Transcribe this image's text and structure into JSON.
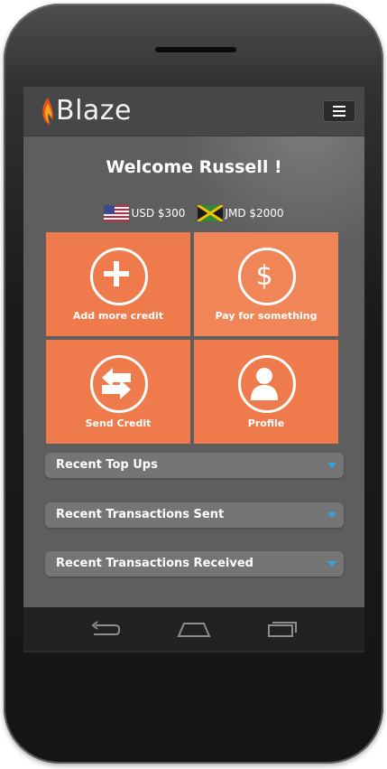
{
  "app": {
    "name": "Blaze",
    "accent_color": "#ef7a4b",
    "caret_color": "#2fa3e6"
  },
  "header": {
    "logo_text": "Blaze",
    "menu_icon": "hamburger-menu-icon"
  },
  "welcome_text": "Welcome Russell !",
  "balances": [
    {
      "flag": "us-flag-icon",
      "text": "USD $300"
    },
    {
      "flag": "jamaica-flag-icon",
      "text": "JMD $2000"
    }
  ],
  "tiles": [
    {
      "icon": "plus-icon",
      "label": "Add more credit"
    },
    {
      "icon": "dollar-icon",
      "label": "Pay for something"
    },
    {
      "icon": "exchange-arrows-icon",
      "label": "Send Credit"
    },
    {
      "icon": "user-icon",
      "label": "Profile"
    }
  ],
  "sections": [
    {
      "label": "Recent Top Ups"
    },
    {
      "label": "Recent Transactions Sent"
    },
    {
      "label": "Recent Transactions Received"
    }
  ],
  "navbar": {
    "back_icon": "back-icon",
    "home_icon": "home-icon",
    "recents_icon": "recent-apps-icon"
  }
}
